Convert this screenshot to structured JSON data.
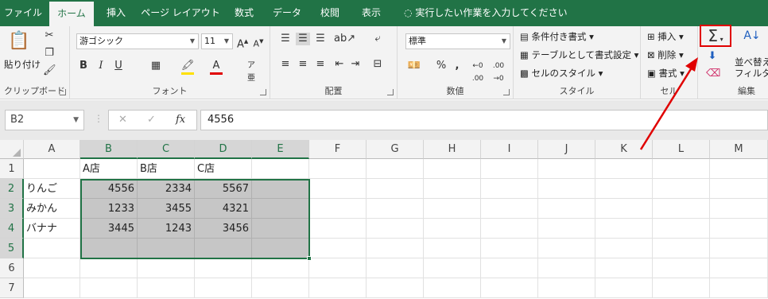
{
  "tabs": [
    "ファイル",
    "ホーム",
    "挿入",
    "ページ レイアウト",
    "数式",
    "データ",
    "校閲",
    "表示"
  ],
  "tell_me": "実行したい作業を入力してください",
  "ribbon": {
    "clipboard": {
      "paste": "貼り付け",
      "label": "クリップボード"
    },
    "font": {
      "name": "游ゴシック",
      "size": "11",
      "label": "フォント"
    },
    "align": {
      "label": "配置"
    },
    "number": {
      "format": "標準",
      "label": "数値"
    },
    "styles": {
      "cond": "条件付き書式",
      "table": "テーブルとして書式設定",
      "cell": "セルのスタイル",
      "label": "スタイル"
    },
    "cells": {
      "insert": "挿入",
      "delete": "削除",
      "format": "書式",
      "label": "セル"
    },
    "edit": {
      "sort": "並べ替え",
      "filter": "フィルター",
      "label": "編集",
      "sum_glyph": "Σ"
    }
  },
  "formula_bar": {
    "name_box": "B2",
    "fx": "fx",
    "value": "4556"
  },
  "accent": "#217346",
  "annotation_color": "#e00000",
  "sheet": {
    "columns": [
      "A",
      "B",
      "C",
      "D",
      "E",
      "F",
      "G",
      "H",
      "I",
      "J",
      "K",
      "L",
      "M"
    ],
    "rows": [
      "1",
      "2",
      "3",
      "4",
      "5",
      "6",
      "7"
    ],
    "cells": [
      [
        "",
        "A店",
        "B店",
        "C店",
        ""
      ],
      [
        "りんご",
        "4556",
        "2334",
        "5567",
        ""
      ],
      [
        "みかん",
        "1233",
        "3455",
        "4321",
        ""
      ],
      [
        "バナナ",
        "3445",
        "1243",
        "3456",
        ""
      ],
      [
        "",
        "",
        "",
        "",
        ""
      ],
      [
        "",
        "",
        "",
        "",
        ""
      ],
      [
        "",
        "",
        "",
        "",
        ""
      ]
    ]
  }
}
